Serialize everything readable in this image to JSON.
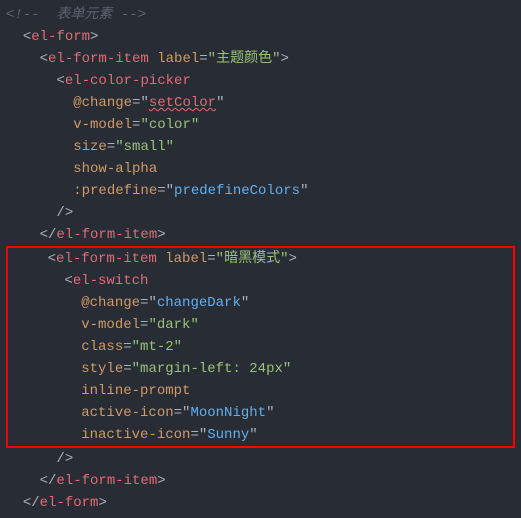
{
  "line1": {
    "comment_open": "<!-- ",
    "comment_text": " 表单元素 ",
    "comment_close": "-->"
  },
  "tags": {
    "elForm": "el-form",
    "elFormItem": "el-form-item",
    "elColorPicker": "el-color-picker",
    "elSwitch": "el-switch"
  },
  "attrs": {
    "label": "label",
    "atChange": "@change",
    "vModel": "v-model",
    "size": "size",
    "showAlpha": "show-alpha",
    "predefine": ":predefine",
    "classAttr": "class",
    "styleAttr": "style",
    "inlinePrompt": "inline-prompt",
    "activeIcon": "active-icon",
    "inactiveIcon": "inactive-icon"
  },
  "vals": {
    "themeColorLabel": "主题颜色",
    "setColor": "setColor",
    "color": "color",
    "small": "small",
    "predefineColors": "predefineColors",
    "darkModeLabel": "暗黑模式",
    "changeDark": "changeDark",
    "dark": "dark",
    "mt2": "mt-2",
    "marginLeft": "margin-left: 24px",
    "moonNight": "MoonNight",
    "sunny": "Sunny"
  },
  "punct": {
    "lt": "<",
    "gt": ">",
    "ltSlash": "</",
    "selfClose": "/>",
    "eq": "=",
    "q": "\""
  }
}
